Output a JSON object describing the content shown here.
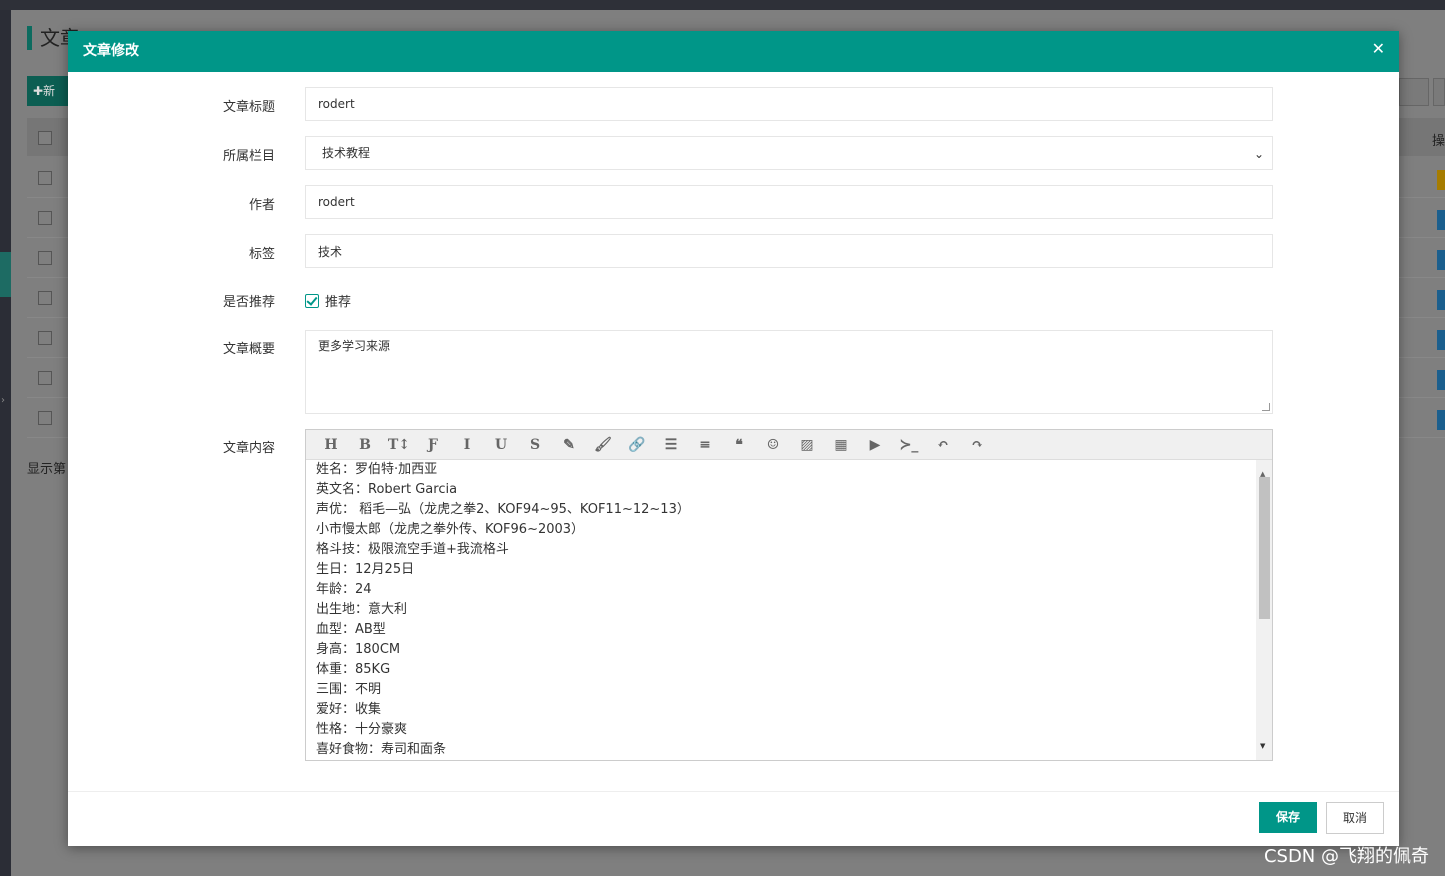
{
  "background": {
    "page_title": "文章",
    "add_button": "✚新",
    "footer_text": "显示第",
    "last_col": "操"
  },
  "modal": {
    "title": "文章修改",
    "close_icon": "✕",
    "fields": {
      "title_label": "文章标题",
      "title_value": "rodert",
      "category_label": "所属栏目",
      "category_value": "技术教程",
      "author_label": "作者",
      "author_value": "rodert",
      "tags_label": "标签",
      "tags_value": "技术",
      "recommend_label": "是否推荐",
      "recommend_option": "推荐",
      "recommend_checked": true,
      "summary_label": "文章概要",
      "summary_value": "更多学习来源",
      "content_label": "文章内容"
    },
    "toolbar_icons": [
      "heading-icon",
      "bold-icon",
      "font-size-icon",
      "font-icon",
      "italic-icon",
      "underline-icon",
      "strikethrough-icon",
      "eraser-icon",
      "brush-icon",
      "link-icon",
      "list-icon",
      "align-icon",
      "quote-icon",
      "emoji-icon",
      "image-icon",
      "table-icon",
      "video-icon",
      "code-icon",
      "undo-icon",
      "redo-icon"
    ],
    "toolbar_glyphs": [
      "H",
      "B",
      "T↕",
      "Ƒ",
      "I",
      "U",
      "S",
      "✎",
      "🖌",
      "🔗",
      "☰",
      "≡",
      "❝",
      "☺",
      "▨",
      "▦",
      "▶",
      "≻_",
      "↶",
      "↷"
    ],
    "content_lines": [
      "姓名：罗伯特·加西亚",
      "英文名：Robert Garcia",
      "声优： 稻毛—弘（龙虎之拳2、KOF94~95、KOF11~12~13）",
      "小市慢太郎（龙虎之拳外传、KOF96~2003）",
      "格斗技：极限流空手道+我流格斗",
      "生日：12月25日",
      "年龄：24",
      "出生地：意大利",
      "血型：AB型",
      "身高：180CM",
      "体重：85KG",
      "三围：不明",
      "爱好：收集",
      "性格：十分豪爽",
      "喜好食物：寿司和面条"
    ],
    "buttons": {
      "save": "保存",
      "cancel": "取消"
    }
  },
  "watermark": "CSDN @飞翔的佩奇"
}
